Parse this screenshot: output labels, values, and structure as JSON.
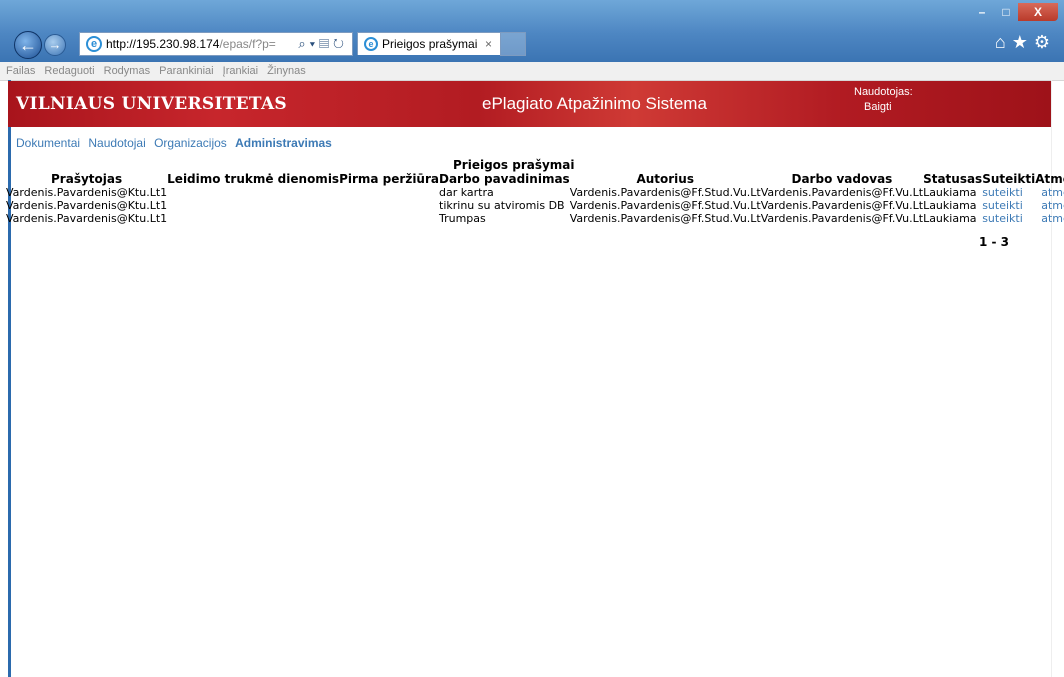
{
  "browser": {
    "url_host": "http://195.230.98.174",
    "url_path": "/epas/f?p=",
    "tab_title": "Prieigos prašymai",
    "tab_close": "×",
    "menu": [
      "Failas",
      "Redaguoti",
      "Rodymas",
      "Parankiniai",
      "Įrankiai",
      "Žinynas"
    ]
  },
  "banner": {
    "university": "VILNIAUS UNIVERSITETAS",
    "system_name": "ePlagiato Atpažinimo Sistema",
    "user_label": "Naudotojas:",
    "logout_label": "Baigti"
  },
  "nav": {
    "items": [
      "Dokumentai",
      "Naudotojai",
      "Organizacijos",
      "Administravimas"
    ],
    "active": "Administravimas"
  },
  "table": {
    "caption": "Prieigos prašymai",
    "headers": [
      "Prašytojas",
      "Leidimo trukmė dienomis",
      "Pirma peržiūra",
      "Darbo pavadinimas",
      "Autorius",
      "Darbo vadovas",
      "Statusas",
      "Suteikti",
      "Atmesti"
    ],
    "rows": [
      {
        "requester": "Vardenis.Pavardenis@Ktu.Lt1",
        "duration": "",
        "first_view": "",
        "title": "dar kartra",
        "author": "Vardenis.Pavardenis@Ff.Stud.Vu.Lt",
        "supervisor": "Vardenis.Pavardenis@Ff.Vu.Lt",
        "status": "Laukiama",
        "grant": "suteikti",
        "reject": "atmesti"
      },
      {
        "requester": "Vardenis.Pavardenis@Ktu.Lt1",
        "duration": "",
        "first_view": "",
        "title": "tikrinu su atviromis DB",
        "author": "Vardenis.Pavardenis@Ff.Stud.Vu.Lt",
        "supervisor": "Vardenis.Pavardenis@Ff.Vu.Lt",
        "status": "Laukiama",
        "grant": "suteikti",
        "reject": "atmesti"
      },
      {
        "requester": "Vardenis.Pavardenis@Ktu.Lt1",
        "duration": "",
        "first_view": "",
        "title": "Trumpas",
        "author": "Vardenis.Pavardenis@Ff.Stud.Vu.Lt",
        "supervisor": "Vardenis.Pavardenis@Ff.Vu.Lt",
        "status": "Laukiama",
        "grant": "suteikti",
        "reject": "atmesti"
      }
    ],
    "pagination": "1 - 3"
  }
}
